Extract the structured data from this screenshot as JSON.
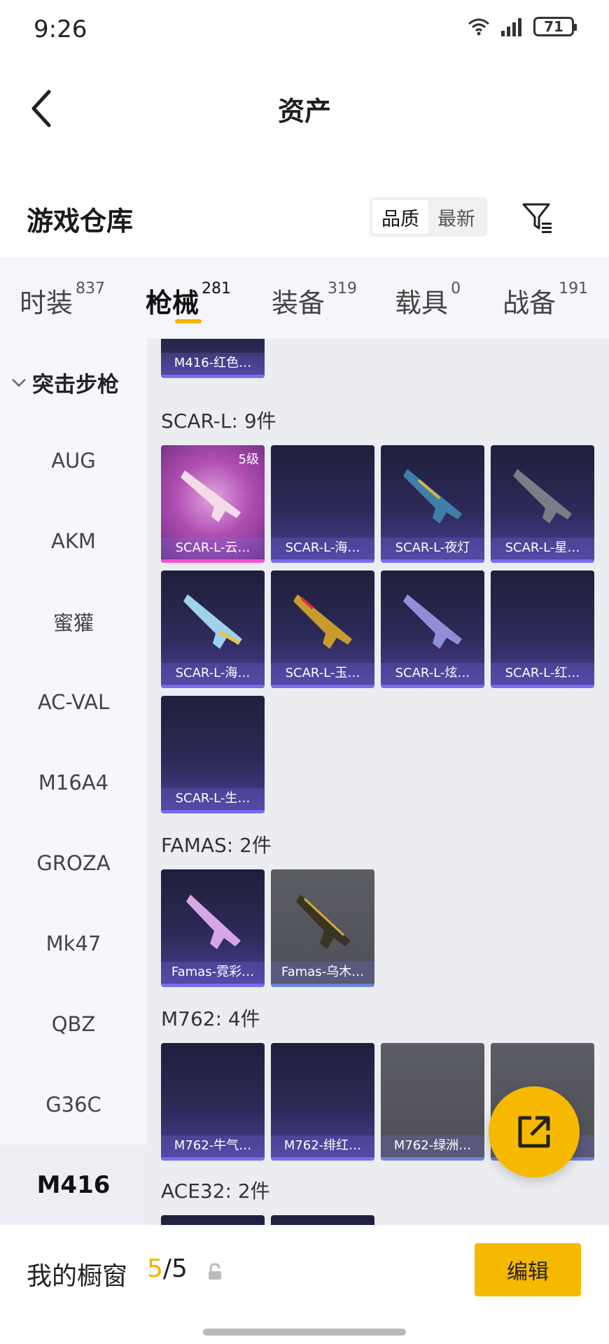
{
  "status": {
    "time": "9:26",
    "battery": "71",
    "wifi_label": "6",
    "network_label": "4G"
  },
  "header": {
    "title": "资产"
  },
  "section": {
    "title": "游戏仓库"
  },
  "sort": {
    "options": [
      "品质",
      "最新"
    ],
    "selected": "品质"
  },
  "tabs": [
    {
      "label": "时装",
      "count": "837"
    },
    {
      "label": "枪械",
      "count": "281",
      "active": true
    },
    {
      "label": "装备",
      "count": "319"
    },
    {
      "label": "载具",
      "count": "0"
    },
    {
      "label": "战备",
      "count": "191"
    }
  ],
  "sidebar": {
    "group": "突击步枪",
    "items": [
      "AUG",
      "AKM",
      "蜜獾",
      "AC-VAL",
      "M16A4",
      "GROZA",
      "Mk47",
      "QBZ",
      "G36C",
      "M416"
    ],
    "active": "M416"
  },
  "content": {
    "top_card": {
      "name": "M416-红色…"
    },
    "groups": [
      {
        "title": "SCAR-L: 9件",
        "items": [
          {
            "name": "SCAR-L-云…",
            "level": "5级",
            "style": "pink"
          },
          {
            "name": "SCAR-L-海…",
            "style": "dark"
          },
          {
            "name": "SCAR-L-夜灯",
            "style": "dark"
          },
          {
            "name": "SCAR-L-星…",
            "style": "dark"
          },
          {
            "name": "SCAR-L-海…",
            "style": "dark"
          },
          {
            "name": "SCAR-L-玉…",
            "style": "dark"
          },
          {
            "name": "SCAR-L-炫…",
            "style": "dark"
          },
          {
            "name": "SCAR-L-红…",
            "style": "dark"
          },
          {
            "name": "SCAR-L-生…",
            "style": "dark"
          }
        ]
      },
      {
        "title": "FAMAS: 2件",
        "items": [
          {
            "name": "Famas-霓彩…",
            "style": "dark"
          },
          {
            "name": "Famas-乌木…",
            "style": "grey"
          }
        ]
      },
      {
        "title": "M762: 4件",
        "items": [
          {
            "name": "M762-牛气…",
            "style": "dark"
          },
          {
            "name": "M762-绯红…",
            "style": "dark"
          },
          {
            "name": "M762-绿洲…",
            "style": "grey"
          },
          {
            "name": "…",
            "style": "grey"
          }
        ]
      },
      {
        "title": "ACE32: 2件",
        "items": []
      }
    ]
  },
  "bottom": {
    "label": "我的橱窗",
    "count_current": "5",
    "count_sep": "/",
    "count_max": "5",
    "edit_label": "编辑"
  },
  "colors": {
    "accent": "#f7b800",
    "card_dark": "#2c2a58",
    "card_grey": "#55565d"
  },
  "icons": {
    "back": "chevron-left-icon",
    "filter": "filter-icon",
    "fab": "share-icon",
    "lock": "lock-icon"
  }
}
